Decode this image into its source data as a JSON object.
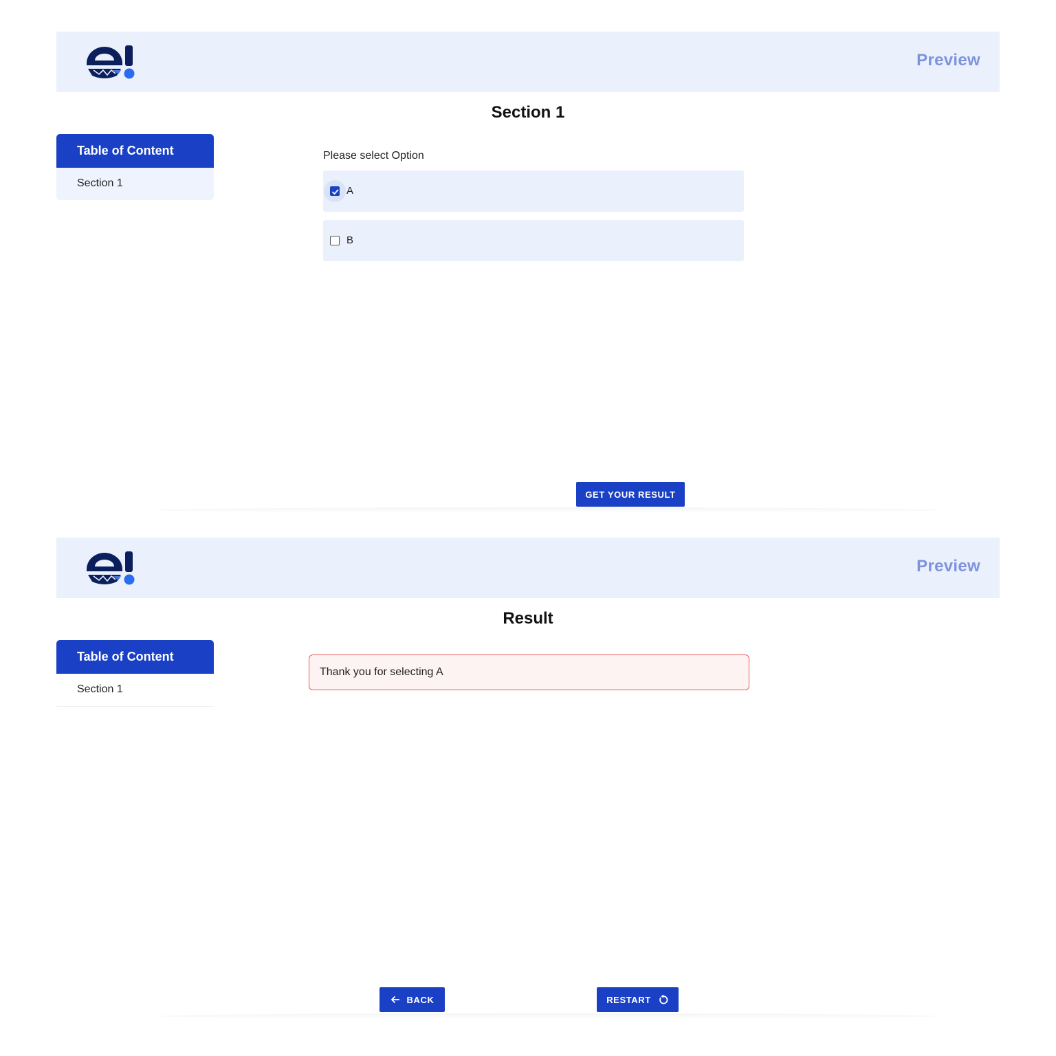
{
  "colors": {
    "primary": "#1a41c5",
    "header_bg": "#eaf1fd",
    "preview_text": "#7e93dc",
    "option_bg": "#eaf1fd",
    "result_border": "#e35b57",
    "result_bg": "#fef3f3",
    "logo_dark": "#0b1f5c",
    "logo_dot": "#2a6cf0"
  },
  "screens": {
    "question": {
      "header": {
        "logo_icon": "e!-logo",
        "preview_label": "Preview"
      },
      "page_title": "Section 1",
      "toc": {
        "heading": "Table of Content",
        "items": [
          {
            "label": "Section 1"
          }
        ]
      },
      "question": {
        "label": "Please select Option",
        "options": [
          {
            "label": "A",
            "checked": true
          },
          {
            "label": "B",
            "checked": false
          }
        ]
      },
      "actions": {
        "get_result_label": "GET YOUR RESULT"
      }
    },
    "result": {
      "header": {
        "logo_icon": "e!-logo",
        "preview_label": "Preview"
      },
      "page_title": "Result",
      "toc": {
        "heading": "Table of Content",
        "items": [
          {
            "label": "Section 1"
          }
        ]
      },
      "result_message": "Thank you for selecting A",
      "actions": {
        "back_label": "BACK",
        "back_icon": "arrow-left-icon",
        "restart_label": "RESTART",
        "restart_icon": "restart-icon"
      }
    }
  }
}
